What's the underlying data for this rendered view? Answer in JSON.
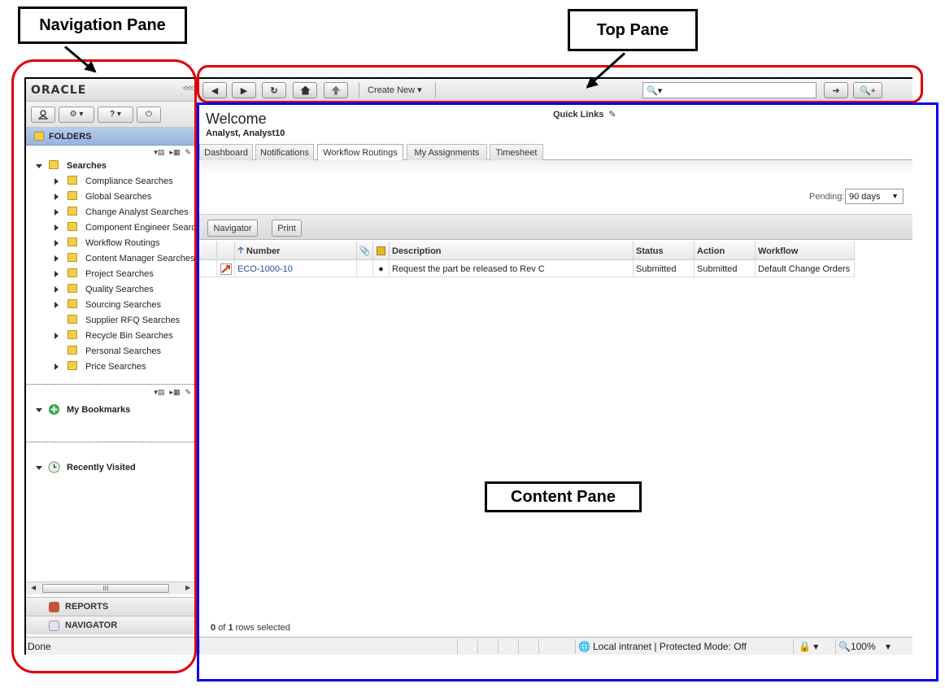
{
  "callouts": {
    "navigation_pane": "Navigation Pane",
    "top_pane": "Top Pane",
    "content_pane": "Content Pane"
  },
  "nav": {
    "logo": "ORACLE",
    "folders_label": "FOLDERS",
    "searches_label": "Searches",
    "search_items": [
      {
        "label": "Compliance Searches",
        "expandable": true
      },
      {
        "label": "Global Searches",
        "expandable": true
      },
      {
        "label": "Change Analyst Searches",
        "expandable": true
      },
      {
        "label": "Component Engineer Search",
        "expandable": true
      },
      {
        "label": "Workflow Routings",
        "expandable": true
      },
      {
        "label": "Content Manager Searches",
        "expandable": true
      },
      {
        "label": "Project Searches",
        "expandable": true
      },
      {
        "label": "Quality Searches",
        "expandable": true
      },
      {
        "label": "Sourcing Searches",
        "expandable": true
      },
      {
        "label": "Supplier RFQ Searches",
        "expandable": false
      },
      {
        "label": "Recycle Bin Searches",
        "expandable": true
      },
      {
        "label": "Personal Searches",
        "expandable": false
      },
      {
        "label": "Price Searches",
        "expandable": true
      }
    ],
    "bookmarks_label": "My Bookmarks",
    "recent_label": "Recently Visited",
    "reports_label": "REPORTS",
    "navigator_label": "NAVIGATOR"
  },
  "topbar": {
    "create_new": "Create New",
    "search_placeholder": ""
  },
  "content": {
    "welcome_title": "Welcome",
    "user": "Analyst, Analyst10",
    "quick_links": "Quick Links",
    "tabs": [
      "Dashboard",
      "Notifications",
      "Workflow Routings",
      "My Assignments",
      "Timesheet"
    ],
    "active_tab": "Workflow Routings",
    "pending_label": "Pending:",
    "pending_value": "90 days",
    "navigator_button": "Navigator",
    "print_button": "Print",
    "columns": {
      "number": "Number",
      "description": "Description",
      "status": "Status",
      "action": "Action",
      "workflow": "Workflow"
    },
    "rows": [
      {
        "number": "ECO-1000-10",
        "description": "Request the part be released to Rev C",
        "status": "Submitted",
        "action": "Submitted",
        "workflow": "Default Change Orders"
      }
    ],
    "rows_selected_count": "0",
    "rows_selected_of": "of",
    "rows_selected_total": "1",
    "rows_selected_suffix": "rows selected"
  },
  "status": {
    "left": "Done",
    "zone": "Local intranet | Protected Mode: Off",
    "zoom": "100%"
  },
  "colors": {
    "outline_red": "#e00000",
    "outline_blue": "#0000ee",
    "folders_header": "#a7c1e4",
    "link": "#1f4f9a"
  }
}
